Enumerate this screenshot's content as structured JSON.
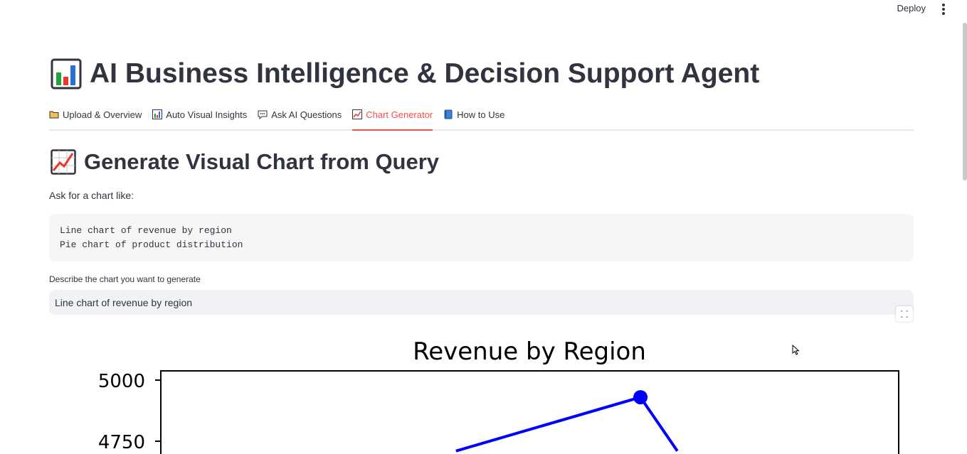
{
  "header": {
    "deploy_label": "Deploy"
  },
  "page": {
    "title": "AI Business Intelligence & Decision Support Agent"
  },
  "tabs": [
    {
      "label": "Upload & Overview",
      "icon": "folder-icon",
      "active": false
    },
    {
      "label": "Auto Visual Insights",
      "icon": "bar-chart-icon",
      "active": false
    },
    {
      "label": "Ask AI Questions",
      "icon": "speech-bubble-icon",
      "active": false
    },
    {
      "label": "Chart Generator",
      "icon": "line-chart-icon",
      "active": true
    },
    {
      "label": "How to Use",
      "icon": "book-icon",
      "active": false
    }
  ],
  "section": {
    "title": "Generate Visual Chart from Query",
    "ask_text": "Ask for a chart like:",
    "examples": [
      "Line chart of revenue by region",
      "Pie chart of product distribution"
    ]
  },
  "query": {
    "label": "Describe the chart you want to generate",
    "value": "Line chart of revenue by region"
  },
  "colors": {
    "accent": "#ff4b4b",
    "text": "#31333f",
    "code_bg": "#f6f6f7",
    "input_bg": "#f0f2f6",
    "line": "#0000ff"
  },
  "chart_data": {
    "type": "line",
    "title": "Revenue by Region",
    "y_ticks": [
      {
        "value": 5000,
        "label": "5000"
      },
      {
        "value": 4750,
        "label": "4750"
      }
    ],
    "ylim_visible": [
      4710,
      5040
    ],
    "x_visible": [
      0,
      1
    ],
    "points": [
      {
        "x": 0.4,
        "y": 4710
      },
      {
        "x": 0.65,
        "y": 4930
      },
      {
        "x": 0.7,
        "y": 4710
      }
    ],
    "series_color": "#0000ff"
  }
}
